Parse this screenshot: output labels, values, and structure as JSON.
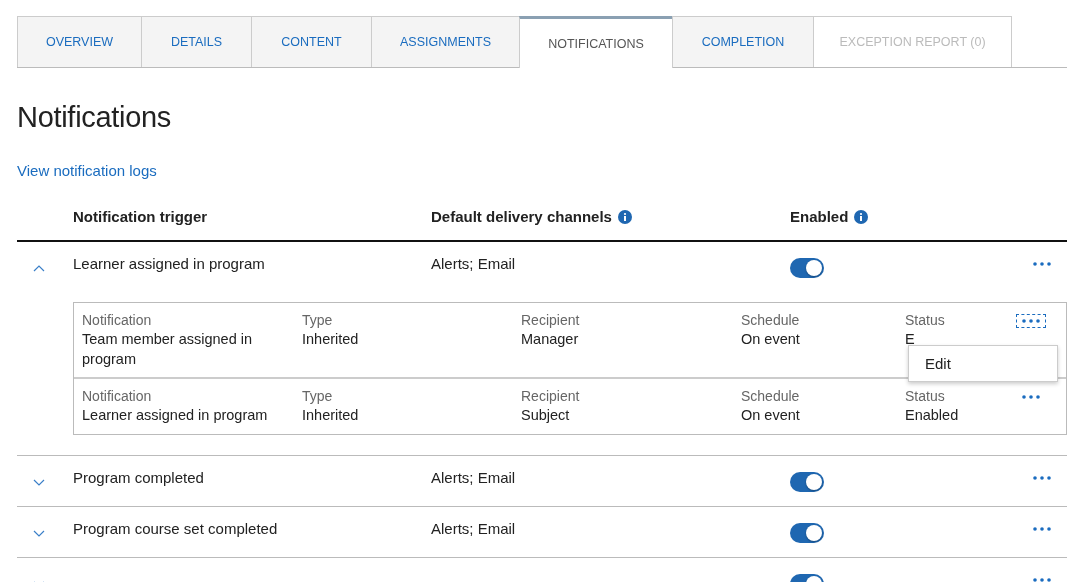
{
  "tabs": [
    {
      "label": "OVERVIEW",
      "selected": false,
      "disabled": false
    },
    {
      "label": "DETAILS",
      "selected": false,
      "disabled": false
    },
    {
      "label": "CONTENT",
      "selected": false,
      "disabled": false
    },
    {
      "label": "ASSIGNMENTS",
      "selected": false,
      "disabled": false
    },
    {
      "label": "NOTIFICATIONS",
      "selected": true,
      "disabled": false
    },
    {
      "label": "COMPLETION",
      "selected": false,
      "disabled": false
    },
    {
      "label": "EXCEPTION REPORT (0)",
      "selected": false,
      "disabled": true
    }
  ],
  "heading": "Notifications",
  "logs_link": "View notification logs",
  "table": {
    "columns": [
      "Notification trigger",
      "Default delivery channels",
      "Enabled"
    ],
    "rows": [
      {
        "trigger": "Learner assigned in program",
        "channels": "Alerts; Email",
        "enabled": true,
        "expanded": true,
        "notifications": [
          {
            "fields": [
              {
                "label": "Notification",
                "value": "Team member assigned in program"
              },
              {
                "label": "Type",
                "value": "Inherited"
              },
              {
                "label": "Recipient",
                "value": "Manager"
              },
              {
                "label": "Schedule",
                "value": "On event"
              },
              {
                "label": "Status",
                "value": "E"
              }
            ],
            "menu_open": true,
            "menu": [
              "Edit"
            ]
          },
          {
            "fields": [
              {
                "label": "Notification",
                "value": "Learner assigned in program"
              },
              {
                "label": "Type",
                "value": "Inherited"
              },
              {
                "label": "Recipient",
                "value": "Subject"
              },
              {
                "label": "Schedule",
                "value": "On event"
              },
              {
                "label": "Status",
                "value": "Enabled"
              }
            ],
            "menu_open": false
          }
        ]
      },
      {
        "trigger": "Program completed",
        "channels": "Alerts; Email",
        "enabled": true,
        "expanded": false
      },
      {
        "trigger": "Program course set completed",
        "channels": "Alerts; Email",
        "enabled": true,
        "expanded": false
      },
      {
        "enabled": true,
        "expanded": false
      }
    ]
  }
}
